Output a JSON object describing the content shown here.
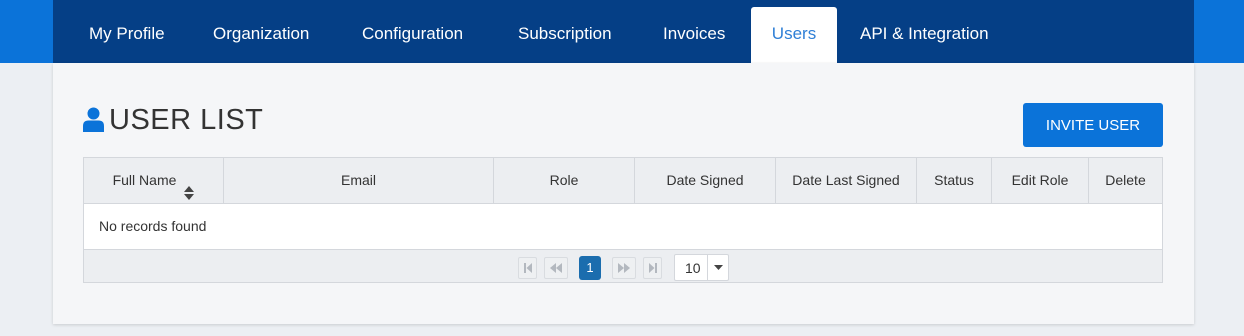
{
  "nav": {
    "tabs": [
      {
        "label": "My Profile"
      },
      {
        "label": "Organization"
      },
      {
        "label": "Configuration"
      },
      {
        "label": "Subscription"
      },
      {
        "label": "Invoices"
      },
      {
        "label": "Users",
        "active": true
      },
      {
        "label": "API & Integration"
      }
    ]
  },
  "page": {
    "title": "USER LIST",
    "title_icon": "user-icon",
    "invite_button": "INVITE USER"
  },
  "table": {
    "columns": [
      "Full Name",
      "Email",
      "Role",
      "Date Signed",
      "Date Last Signed",
      "Status",
      "Edit Role",
      "Delete"
    ],
    "sort_icon": "sort-icon",
    "empty_message": "No records found"
  },
  "pagination": {
    "current_page": "1",
    "per_page": "10",
    "icons": [
      "first-page-icon",
      "prev-page-icon",
      "next-page-icon",
      "last-page-icon",
      "chevron-down-icon"
    ]
  },
  "colors": {
    "brand_blue": "#0b73d9",
    "nav_dark": "#053f86",
    "active_tab_text": "#2f7fd6",
    "page_button": "#1b6dae"
  }
}
